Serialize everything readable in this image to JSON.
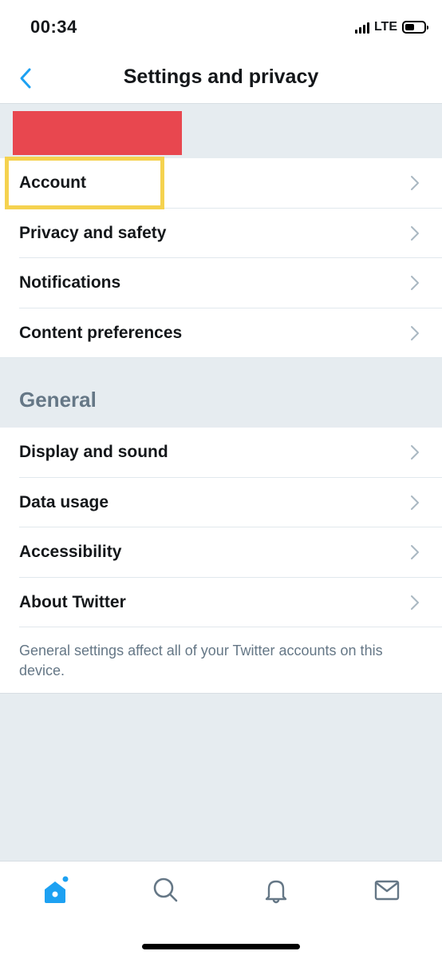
{
  "status_bar": {
    "time": "00:34",
    "network": "LTE"
  },
  "nav": {
    "title": "Settings and privacy"
  },
  "account_rows": [
    {
      "label": "Account"
    },
    {
      "label": "Privacy and safety"
    },
    {
      "label": "Notifications"
    },
    {
      "label": "Content preferences"
    }
  ],
  "general": {
    "title": "General",
    "rows": [
      {
        "label": "Display and sound"
      },
      {
        "label": "Data usage"
      },
      {
        "label": "Accessibility"
      },
      {
        "label": "About Twitter"
      }
    ],
    "note": "General settings affect all of your Twitter accounts on this device."
  },
  "tabs": [
    {
      "icon": "home-icon",
      "active": true
    },
    {
      "icon": "search-icon",
      "active": false
    },
    {
      "icon": "bell-icon",
      "active": false
    },
    {
      "icon": "mail-icon",
      "active": false
    }
  ],
  "colors": {
    "accent": "#1da1f2",
    "redaction": "#e8474f",
    "highlight": "#f5d24f",
    "secondary_text": "#657786",
    "background": "#e6ecf0"
  }
}
